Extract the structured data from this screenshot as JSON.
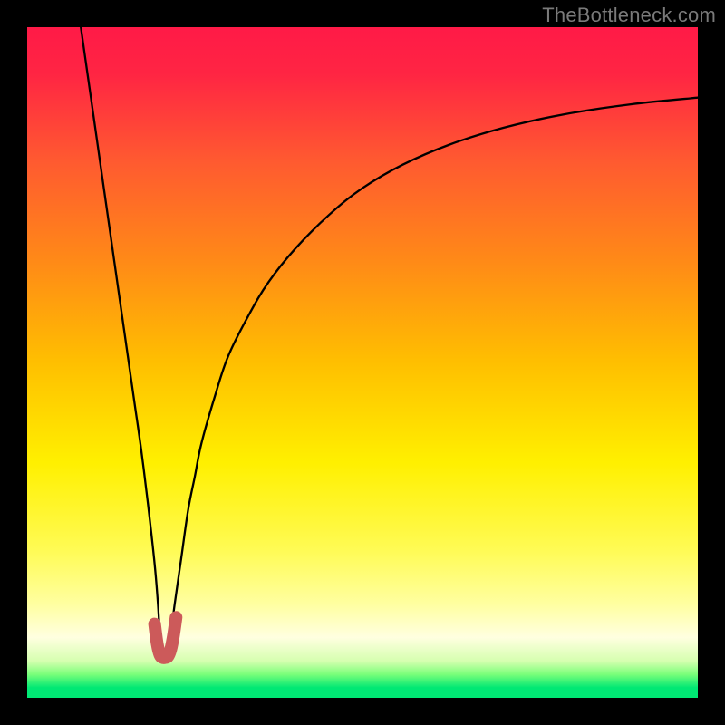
{
  "watermark": "TheBottleneck.com",
  "chart_data": {
    "type": "line",
    "title": "",
    "xlabel": "",
    "ylabel": "",
    "xlim": [
      0,
      100
    ],
    "ylim": [
      0,
      100
    ],
    "background_gradient": {
      "stops": [
        {
          "offset": 0.0,
          "color": "#ff1a47"
        },
        {
          "offset": 0.07,
          "color": "#ff2543"
        },
        {
          "offset": 0.2,
          "color": "#ff5a30"
        },
        {
          "offset": 0.35,
          "color": "#ff8a17"
        },
        {
          "offset": 0.5,
          "color": "#ffbf00"
        },
        {
          "offset": 0.65,
          "color": "#fff000"
        },
        {
          "offset": 0.78,
          "color": "#fffb55"
        },
        {
          "offset": 0.86,
          "color": "#ffffa0"
        },
        {
          "offset": 0.91,
          "color": "#ffffe0"
        },
        {
          "offset": 0.945,
          "color": "#d6ffb0"
        },
        {
          "offset": 0.965,
          "color": "#7aff7a"
        },
        {
          "offset": 0.985,
          "color": "#00e874"
        },
        {
          "offset": 1.0,
          "color": "#00e874"
        }
      ]
    },
    "series": [
      {
        "name": "bottleneck-curve",
        "color": "#000000",
        "stroke_width": 2.3,
        "x": [
          8,
          9,
          10,
          11,
          12,
          13,
          14,
          15,
          16,
          17,
          18,
          19,
          19.5,
          20,
          20.5,
          21,
          22,
          23,
          24,
          25,
          26,
          28,
          30,
          33,
          36,
          40,
          45,
          50,
          56,
          63,
          71,
          80,
          90,
          100
        ],
        "y": [
          100,
          93,
          86,
          79,
          72,
          65,
          58,
          51,
          44,
          37,
          29,
          20,
          14,
          6.5,
          6,
          6.5,
          14,
          21,
          28,
          33,
          38,
          45,
          51,
          57,
          62,
          67,
          72,
          76,
          79.5,
          82.5,
          85,
          87,
          88.5,
          89.5
        ]
      }
    ],
    "markers": [
      {
        "name": "min-region",
        "color": "#cc5a5a",
        "stroke_width": 14,
        "x": [
          19,
          19.4,
          19.8,
          20.2,
          20.6,
          21,
          21.4,
          21.8,
          22.2
        ],
        "y": [
          11,
          8,
          6.4,
          6,
          6,
          6.2,
          7.2,
          9.2,
          12
        ]
      }
    ]
  }
}
